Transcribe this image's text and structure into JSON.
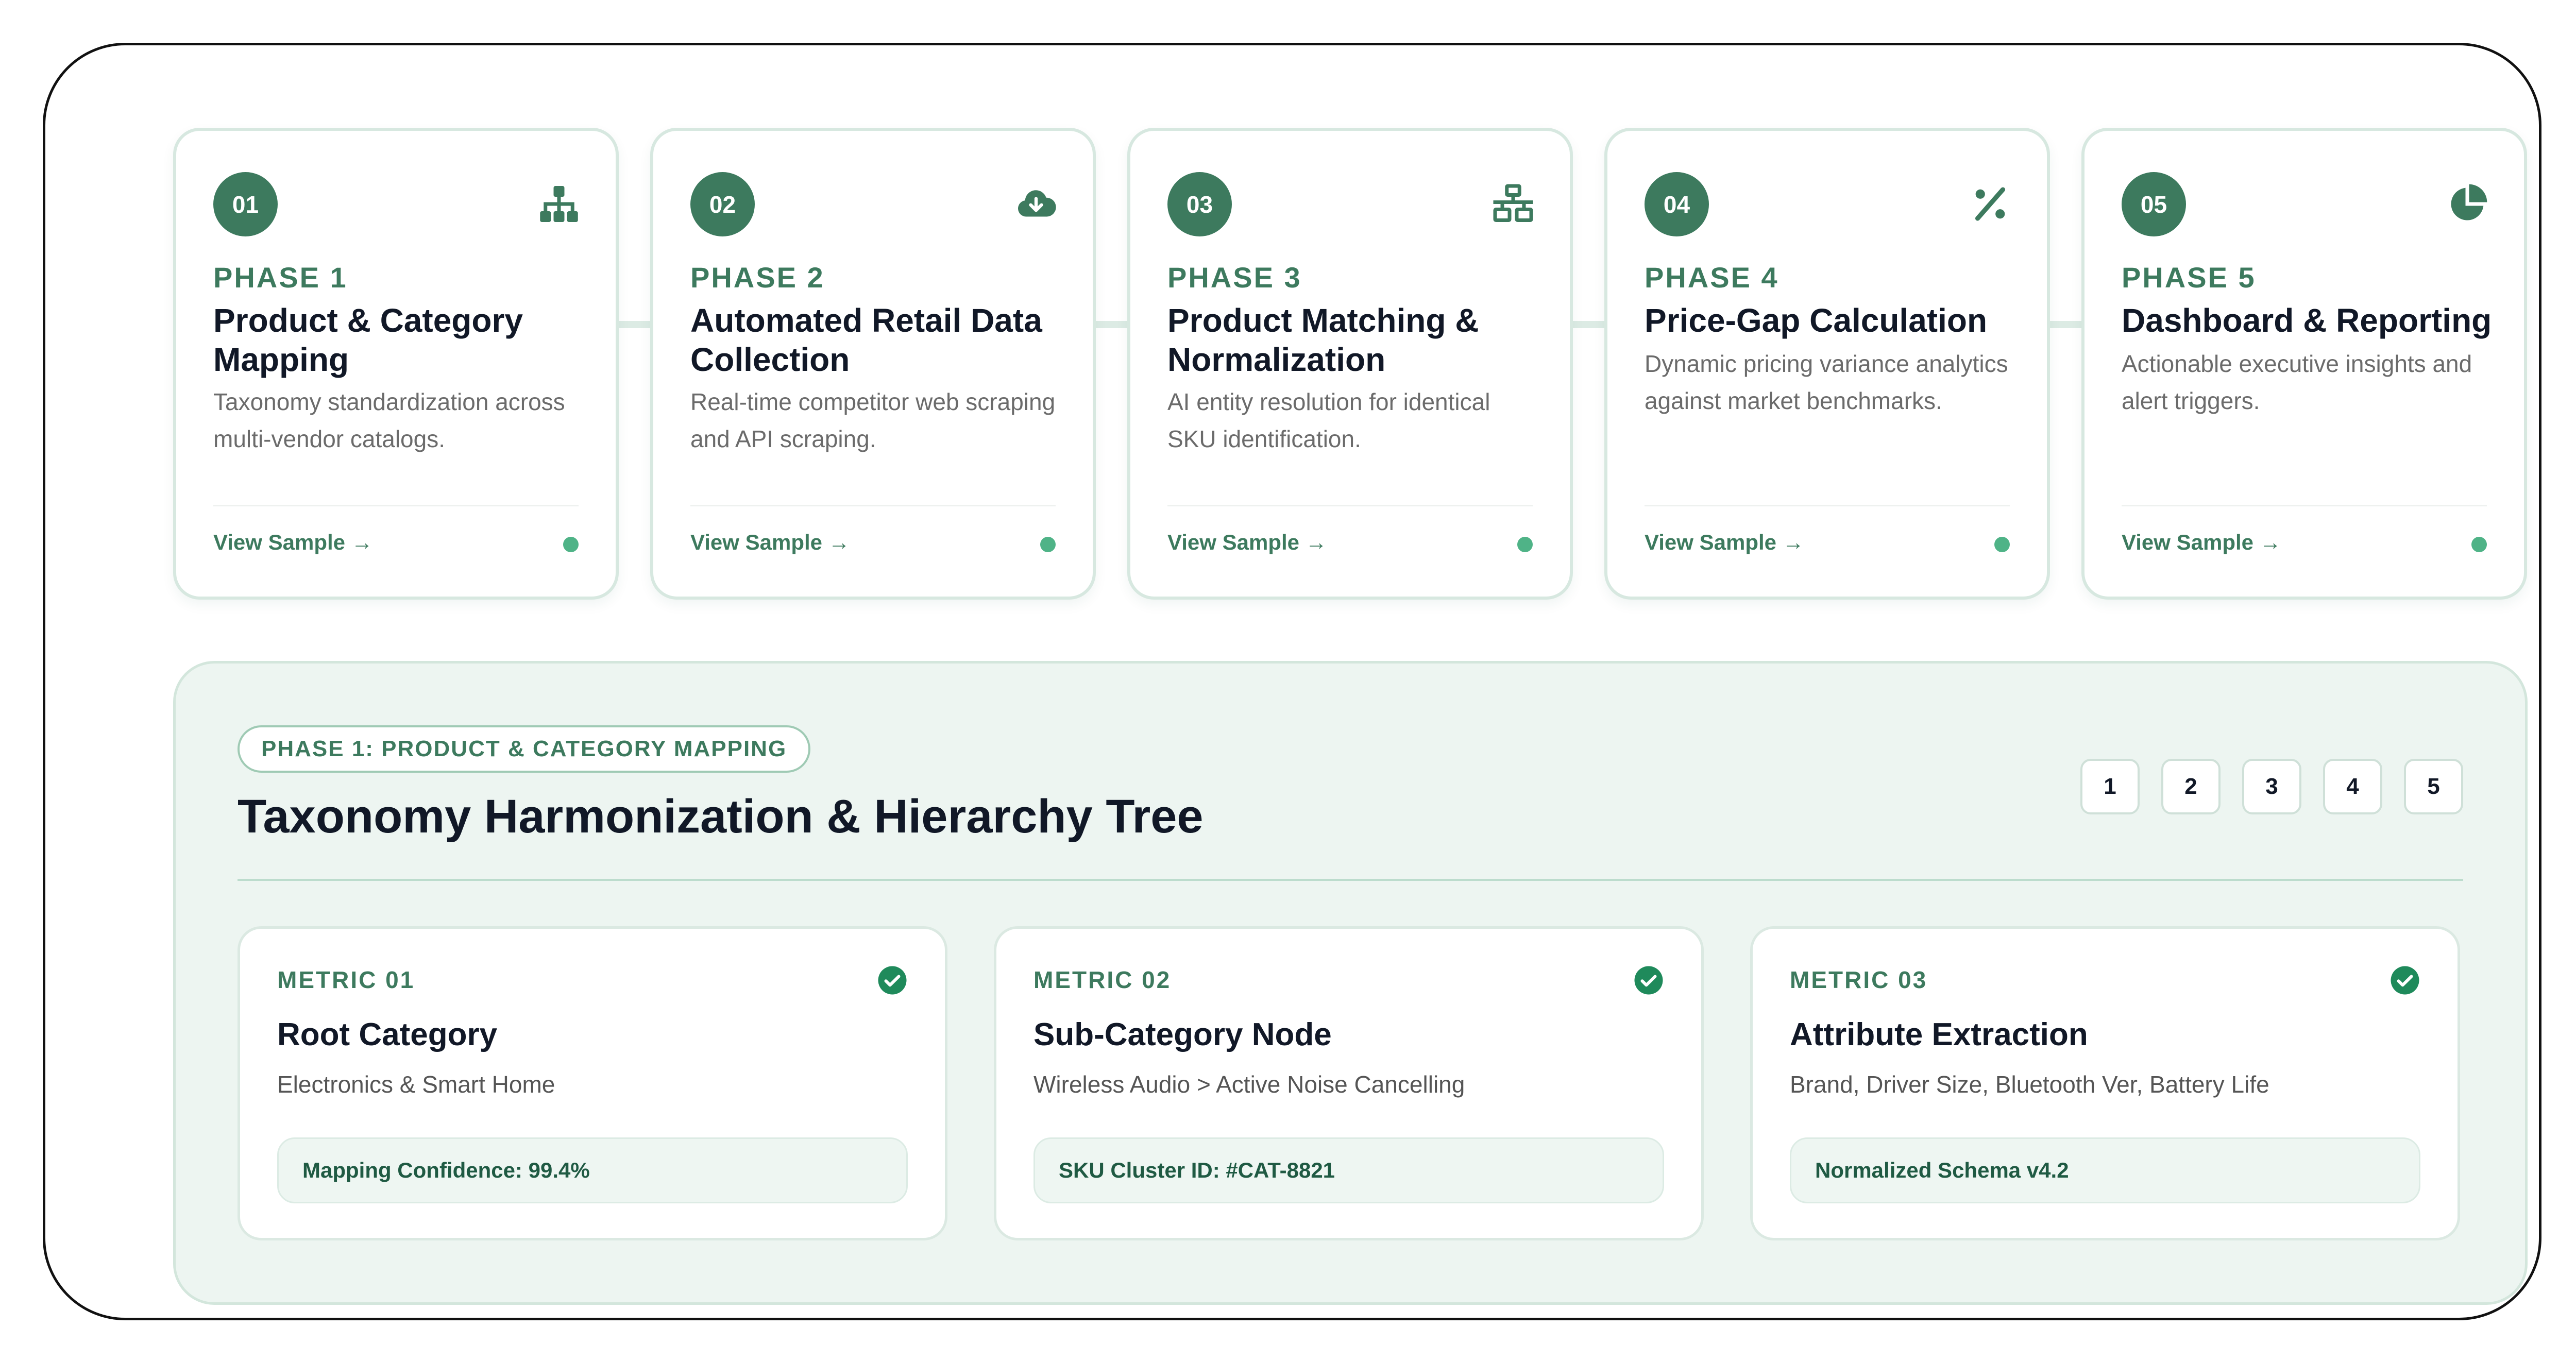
{
  "phases": [
    {
      "number": "01",
      "label": "PHASE 1",
      "title": "Product & Category Mapping",
      "description": "Taxonomy standardization across multi-vendor catalogs.",
      "link": "View Sample →",
      "icon": "sitemap-icon"
    },
    {
      "number": "02",
      "label": "PHASE 2",
      "title": "Automated Retail Data Collection",
      "description": "Real-time competitor web scraping and API scraping.",
      "link": "View Sample →",
      "icon": "cloud-download-icon"
    },
    {
      "number": "03",
      "label": "PHASE 3",
      "title": "Product Matching & Normalization",
      "description": "AI entity resolution for identical SKU identification.",
      "link": "View Sample →",
      "icon": "network-icon"
    },
    {
      "number": "04",
      "label": "PHASE 4",
      "title": "Price-Gap Calculation",
      "description": "Dynamic pricing variance analytics against market benchmarks.",
      "link": "View Sample →",
      "icon": "percent-icon"
    },
    {
      "number": "05",
      "label": "PHASE 5",
      "title": "Dashboard & Reporting",
      "description": "Actionable executive insights and alert triggers.",
      "link": "View Sample →",
      "icon": "pie-chart-icon"
    }
  ],
  "detail": {
    "badge": "PHASE 1: PRODUCT & CATEGORY MAPPING",
    "title": "Taxonomy Harmonization & Hierarchy Tree",
    "pages": [
      "1",
      "2",
      "3",
      "4",
      "5"
    ],
    "metrics": [
      {
        "label": "METRIC 01",
        "title": "Root Category",
        "description": "Electronics & Smart Home",
        "tag": "Mapping Confidence: 99.4%"
      },
      {
        "label": "METRIC 02",
        "title": "Sub-Category Node",
        "description": "Wireless Audio > Active Noise Cancelling",
        "tag": "SKU Cluster ID: #CAT-8821"
      },
      {
        "label": "METRIC 03",
        "title": "Attribute Extraction",
        "description": "Brand, Driver Size, Bluetooth Ver, Battery Life",
        "tag": "Normalized Schema v4.2"
      }
    ]
  },
  "colors": {
    "accent": "#3d7a5e",
    "dot": "#4fb387",
    "check": "#1f8a5b",
    "panel_bg": "#edf5f1"
  }
}
